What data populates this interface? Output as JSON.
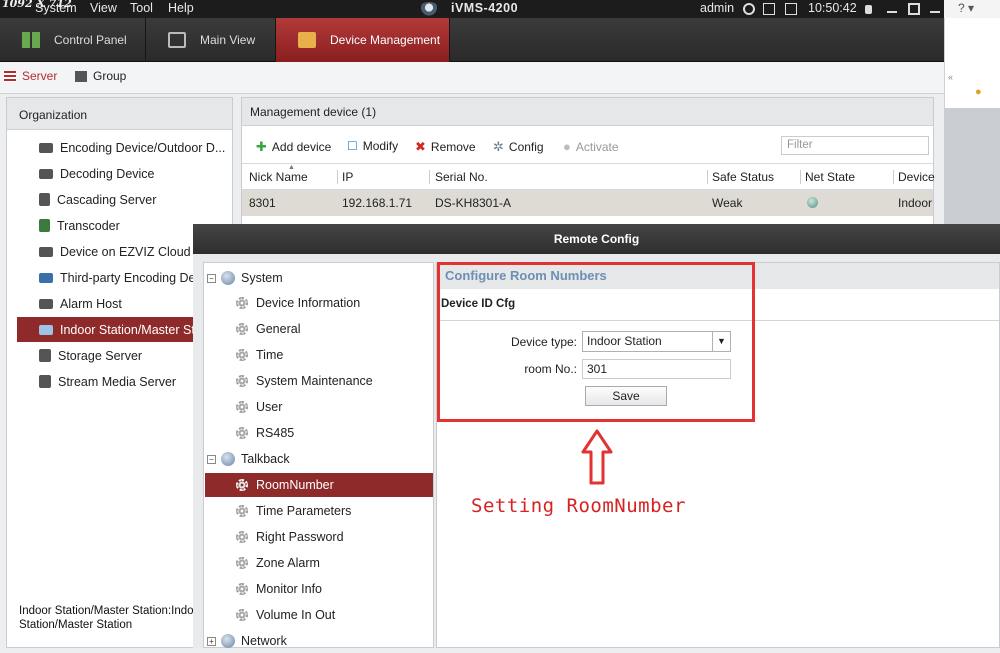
{
  "watermark": "1092 X 712",
  "menubar": {
    "items": [
      "System",
      "View",
      "Tool",
      "Help"
    ],
    "app_title": "iVMS-4200",
    "user": "admin",
    "clock": "10:50:42",
    "logo_icon": "camera-logo-icon"
  },
  "tabs": [
    {
      "label": "Control Panel",
      "icon": "grid-icon"
    },
    {
      "label": "Main View",
      "icon": "monitor-icon"
    },
    {
      "label": "Device Management",
      "icon": "toolbox-icon",
      "active": true
    }
  ],
  "subtabs": [
    {
      "label": "Server",
      "active": true
    },
    {
      "label": "Group"
    }
  ],
  "organization": {
    "title": "Organization",
    "items": [
      "Encoding Device/Outdoor D...",
      "Decoding Device",
      "Cascading Server",
      "Transcoder",
      "Device on EZVIZ Cloud P",
      "Third-party Encoding Dev",
      "Alarm Host",
      "Indoor Station/Master St",
      "Storage Server",
      "Stream Media Server"
    ],
    "selected_index": 7,
    "footer": "Indoor Station/Master Station:Indoor Station/Master Station"
  },
  "management": {
    "title": "Management device (1)",
    "toolbar": {
      "add": "Add device",
      "modify": "Modify",
      "remove": "Remove",
      "config": "Config",
      "activate": "Activate",
      "filter_placeholder": "Filter"
    },
    "columns": [
      "Nick Name",
      "IP",
      "Serial No.",
      "Safe Status",
      "Net State",
      "Device"
    ],
    "row": {
      "nick": "8301",
      "ip": "192.168.1.71",
      "serial": "DS-KH8301-A",
      "safe": "Weak",
      "device": "Indoor"
    }
  },
  "dialog": {
    "title": "Remote Config",
    "tree": {
      "system": "System",
      "system_items": [
        "Device Information",
        "General",
        "Time",
        "System Maintenance",
        "User",
        "RS485"
      ],
      "talkback": "Talkback",
      "talkback_items": [
        "RoomNumber",
        "Time Parameters",
        "Right Password",
        "Zone Alarm",
        "Monitor Info",
        "Volume In Out"
      ],
      "network": "Network",
      "selected": "RoomNumber"
    },
    "config": {
      "heading": "Configure Room Numbers",
      "subheading": "Device ID Cfg",
      "device_type_label": "Device type:",
      "device_type_value": "Indoor Station",
      "room_label": "room No.:",
      "room_value": "301",
      "save": "Save"
    }
  },
  "annotation": {
    "text": "Setting RoomNumber",
    "color": "#e33232"
  }
}
